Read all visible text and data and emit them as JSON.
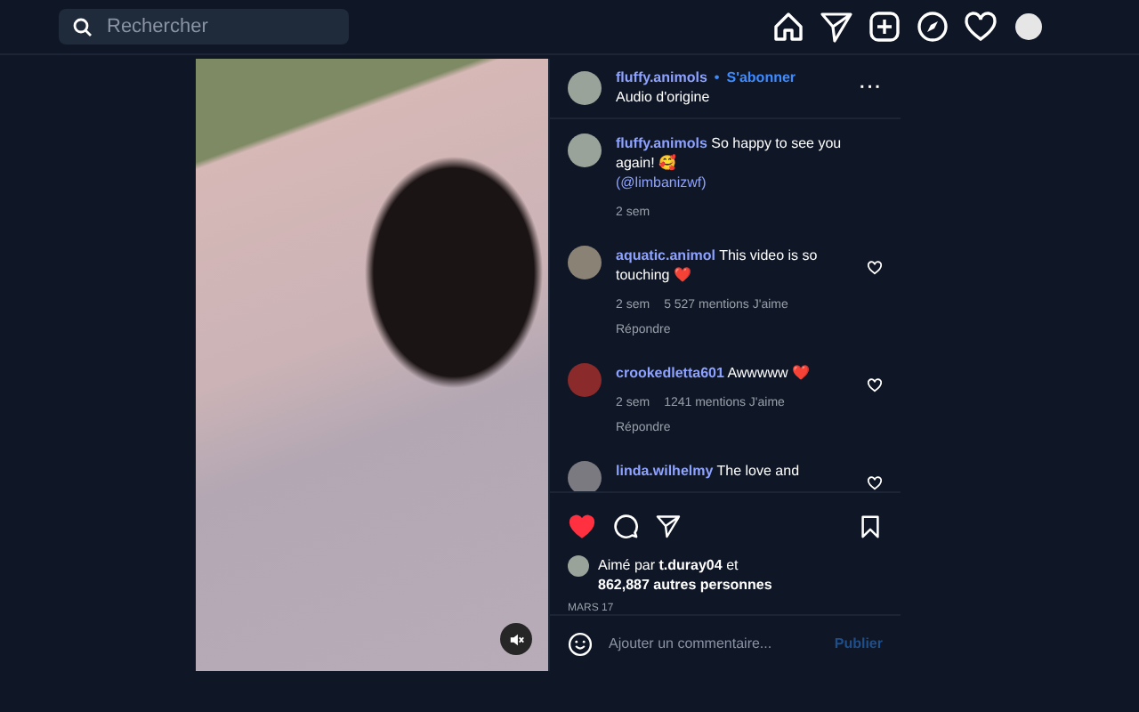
{
  "search": {
    "placeholder": "Rechercher"
  },
  "post": {
    "author": "fluffy.animols",
    "separator": "•",
    "follow": "S'abonner",
    "audio": "Audio d'origine",
    "more": "···",
    "muted": true,
    "caption": {
      "user": "fluffy.animols",
      "text": "So happy to see you again! 🥰",
      "mention": "(@limbanizwf)",
      "time": "2 sem"
    },
    "comments": [
      {
        "user": "aquatic.animol",
        "text": "This video is so touching ❤️",
        "time": "2 sem",
        "likes": "5 527 mentions J'aime",
        "reply": "Répondre",
        "liked": false
      },
      {
        "user": "crookedletta601",
        "text": "Awwwww ❤️",
        "time": "2 sem",
        "likes": "1241 mentions J'aime",
        "reply": "Répondre",
        "liked": false
      },
      {
        "user": "linda.wilhelmy",
        "text": "The love and",
        "liked": false
      }
    ],
    "liked": true,
    "liked_by_prefix": "Aimé par",
    "liked_by_user": "t.duray04",
    "liked_by_and": "et",
    "liked_by_count": "862,887 autres personnes",
    "date": "MARS 17",
    "comment_field": {
      "placeholder": "Ajouter un commentaire..."
    },
    "publish": "Publier"
  }
}
